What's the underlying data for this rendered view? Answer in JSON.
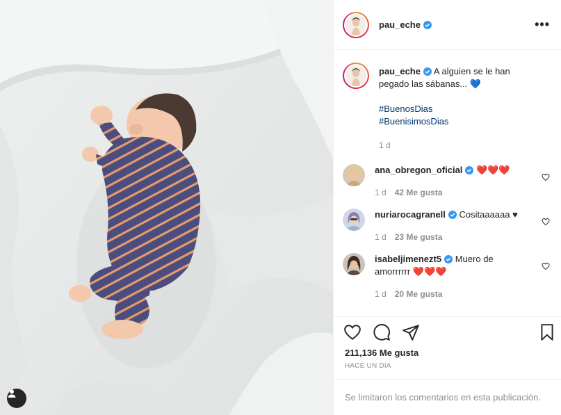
{
  "post": {
    "author": {
      "username": "pau_eche",
      "verified": true
    },
    "caption": {
      "username": "pau_eche",
      "text": "A alguien se le han pegado las sábanas...",
      "emoji": "💙",
      "hashtags": [
        "#BuenosDias",
        "#BuenisimosDias"
      ],
      "time": "1 d"
    },
    "comments": [
      {
        "username": "ana_obregon_oficial",
        "verified": true,
        "text": "❤️❤️❤️",
        "time": "1 d",
        "likes": "42 Me gusta"
      },
      {
        "username": "nuriarocagranell",
        "verified": true,
        "text": "Cositaaaaaa ♥",
        "time": "1 d",
        "likes": "23 Me gusta"
      },
      {
        "username": "isabeljimenezt5",
        "verified": true,
        "text": "Muero de amorrrrrr ❤️❤️❤️",
        "time": "1 d",
        "likes": "20 Me gusta"
      }
    ],
    "like_count": "211,136 Me gusta",
    "posted_ago": "HACE UN DÍA",
    "comments_disabled_text": "Se limitaron los comentarios en esta publicación."
  },
  "colors": {
    "verified_blue": "#3897f0",
    "text_primary": "#262626",
    "text_secondary": "#8e8e8e",
    "hashtag": "#00376b",
    "heart_red": "#ed4956",
    "pajama_navy": "#4b4d7e",
    "pajama_stripe": "#e69b6e"
  },
  "icons": {
    "more": "more-options-icon",
    "verified": "verified-badge-icon",
    "like": "heart-icon",
    "comment": "comment-bubble-icon",
    "share": "paper-plane-icon",
    "save": "bookmark-icon",
    "user_tags": "user-tags-icon"
  }
}
